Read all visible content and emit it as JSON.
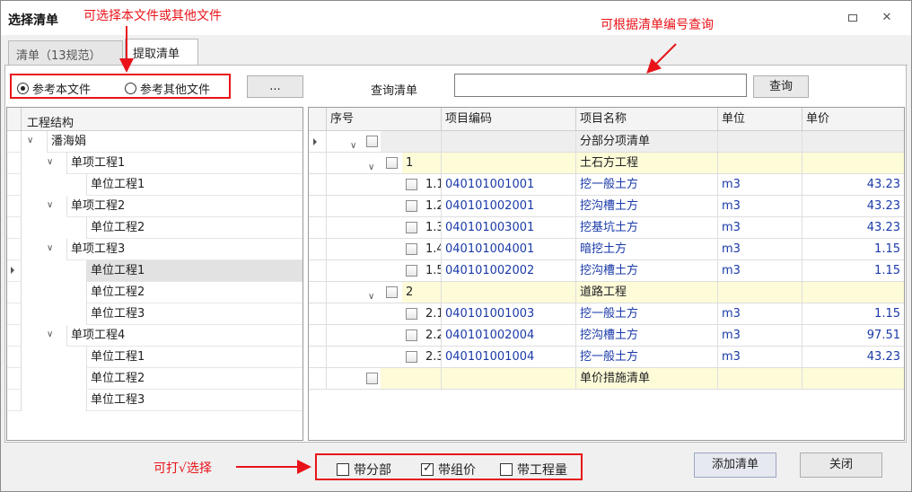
{
  "window": {
    "title": "选择清单"
  },
  "annotations": {
    "choose_file": "可选择本文件或其他文件",
    "query_by_code": "可根据清单编号查询",
    "tick_select": "可打√选择"
  },
  "tabs": [
    {
      "label": "清单（13规范）"
    },
    {
      "label": "提取清单"
    }
  ],
  "source": {
    "option_this_file": "参考本文件",
    "option_other_file": "参考其他文件",
    "browse_label": "..."
  },
  "query": {
    "label": "查询清单",
    "value": "",
    "button_label": "查询"
  },
  "tree": {
    "header": "工程结构",
    "rows": [
      {
        "label": "潘海娟",
        "level": 0,
        "expandable": true
      },
      {
        "label": "单项工程1",
        "level": 1,
        "expandable": true
      },
      {
        "label": "单位工程1",
        "level": 2,
        "expandable": false
      },
      {
        "label": "单项工程2",
        "level": 1,
        "expandable": true
      },
      {
        "label": "单位工程2",
        "level": 2,
        "expandable": false
      },
      {
        "label": "单项工程3",
        "level": 1,
        "expandable": true
      },
      {
        "label": "单位工程1",
        "level": 2,
        "expandable": false,
        "selected": true
      },
      {
        "label": "单位工程2",
        "level": 2,
        "expandable": false
      },
      {
        "label": "单位工程3",
        "level": 2,
        "expandable": false
      },
      {
        "label": "单项工程4",
        "level": 1,
        "expandable": true
      },
      {
        "label": "单位工程1",
        "level": 2,
        "expandable": false
      },
      {
        "label": "单位工程2",
        "level": 2,
        "expandable": false
      },
      {
        "label": "单位工程3",
        "level": 2,
        "expandable": false
      }
    ]
  },
  "grid": {
    "columns": [
      "序号",
      "项目编码",
      "项目名称",
      "单位",
      "单价"
    ],
    "rows": [
      {
        "level": 0,
        "seq": "",
        "code": "",
        "name": "分部分项清单",
        "unit": "",
        "price": "",
        "kind": "grey",
        "expandable": true,
        "current": true
      },
      {
        "level": 1,
        "seq": "1",
        "code": "",
        "name": "土石方工程",
        "unit": "",
        "price": "",
        "kind": "yellow",
        "expandable": true
      },
      {
        "level": 2,
        "seq": "1.1",
        "code": "040101001001",
        "name": "挖一般土方",
        "unit": "m3",
        "price": "43.23",
        "kind": "item"
      },
      {
        "level": 2,
        "seq": "1.2",
        "code": "040101002001",
        "name": "挖沟槽土方",
        "unit": "m3",
        "price": "43.23",
        "kind": "item"
      },
      {
        "level": 2,
        "seq": "1.3",
        "code": "040101003001",
        "name": "挖基坑土方",
        "unit": "m3",
        "price": "43.23",
        "kind": "item"
      },
      {
        "level": 2,
        "seq": "1.4",
        "code": "040101004001",
        "name": "暗挖土方",
        "unit": "m3",
        "price": "1.15",
        "kind": "item"
      },
      {
        "level": 2,
        "seq": "1.5",
        "code": "040101002002",
        "name": "挖沟槽土方",
        "unit": "m3",
        "price": "1.15",
        "kind": "item"
      },
      {
        "level": 1,
        "seq": "2",
        "code": "",
        "name": "道路工程",
        "unit": "",
        "price": "",
        "kind": "yellow",
        "expandable": true
      },
      {
        "level": 2,
        "seq": "2.1",
        "code": "040101001003",
        "name": "挖一般土方",
        "unit": "m3",
        "price": "1.15",
        "kind": "item"
      },
      {
        "level": 2,
        "seq": "2.2",
        "code": "040101002004",
        "name": "挖沟槽土方",
        "unit": "m3",
        "price": "97.51",
        "kind": "item"
      },
      {
        "level": 2,
        "seq": "2.3",
        "code": "040101001004",
        "name": "挖一般土方",
        "unit": "m3",
        "price": "43.23",
        "kind": "item"
      },
      {
        "level": 0,
        "seq": "",
        "code": "",
        "name": "单价措施清单",
        "unit": "",
        "price": "",
        "kind": "yellow",
        "expandable": false
      }
    ]
  },
  "options": {
    "with_division": "带分部",
    "with_division_checked": false,
    "with_group_price": "带组价",
    "with_group_price_checked": true,
    "with_quantity": "带工程量",
    "with_quantity_checked": false
  },
  "buttons": {
    "add": "添加清单",
    "close": "关闭"
  },
  "colors": {
    "annotation_red": "#e8141a",
    "yellow_row": "#fdfbd8",
    "code_blue": "#1a3aa8"
  }
}
